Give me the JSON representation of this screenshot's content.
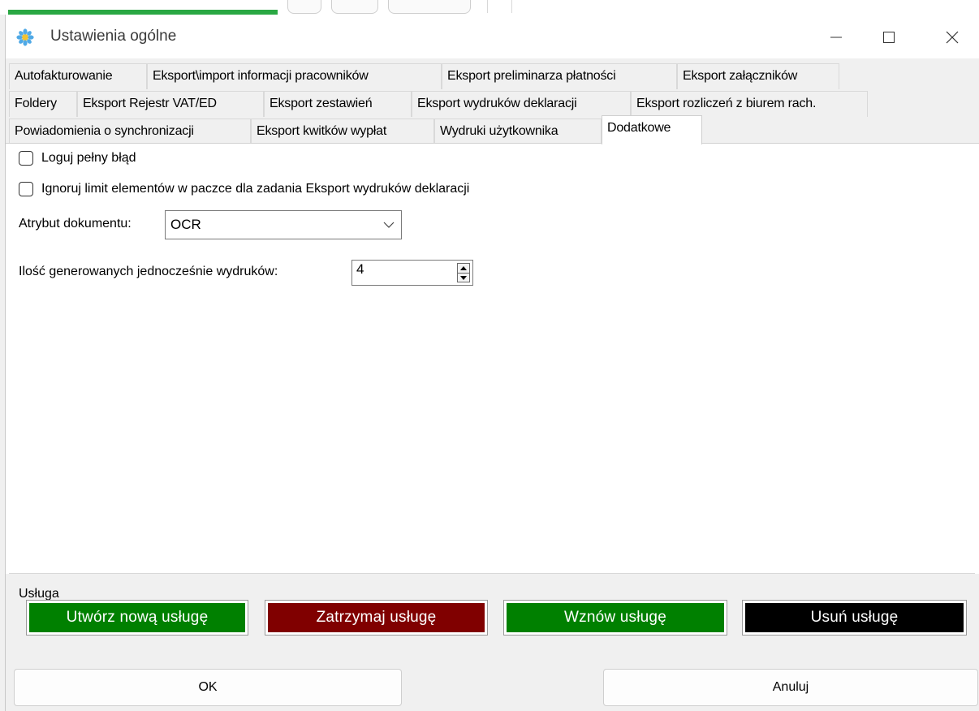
{
  "window": {
    "title": "Ustawienia ogólne"
  },
  "tabs": {
    "row1": [
      "Autofakturowanie",
      "Eksport\\import informacji  pracowników",
      "Eksport preliminarza płatności",
      "Eksport załączników"
    ],
    "row2": [
      "Foldery",
      "Eksport Rejestr VAT/ED",
      "Eksport zestawień",
      "Eksport wydruków deklaracji",
      "Eksport rozliczeń z biurem rach."
    ],
    "row3": [
      "Powiadomienia o synchronizacji",
      "Eksport kwitków wypłat",
      "Wydruki użytkownika",
      "Dodatkowe"
    ],
    "active": "Dodatkowe"
  },
  "settings": {
    "log_full_error_label": "Loguj pełny błąd",
    "log_full_error_checked": false,
    "ignore_limit_label": "Ignoruj limit elementów w paczce dla zadania  Eksport wydruków deklaracji",
    "ignore_limit_checked": false,
    "doc_attribute_label": "Atrybut dokumentu:",
    "doc_attribute_value": "OCR",
    "concurrent_prints_label": "Ilość generowanych jednocześnie wydruków:",
    "concurrent_prints_value": "4"
  },
  "service": {
    "group_title": "Usługa",
    "create_label": "Utwórz nową usługę",
    "stop_label": "Zatrzymaj usługę",
    "resume_label": "Wznów usługę",
    "delete_label": "Usuń usługę",
    "colors": {
      "create": "#008000",
      "stop": "#800000",
      "resume": "#008000",
      "delete": "#000000"
    }
  },
  "dialog": {
    "ok_label": "OK",
    "cancel_label": "Anuluj"
  },
  "icons": {
    "app": "flower-icon",
    "minimize": "minimize-icon",
    "maximize": "maximize-icon",
    "close": "close-icon",
    "dropdown": "chevron-down-icon",
    "spin_up": "arrow-up-icon",
    "spin_down": "arrow-down-icon"
  }
}
